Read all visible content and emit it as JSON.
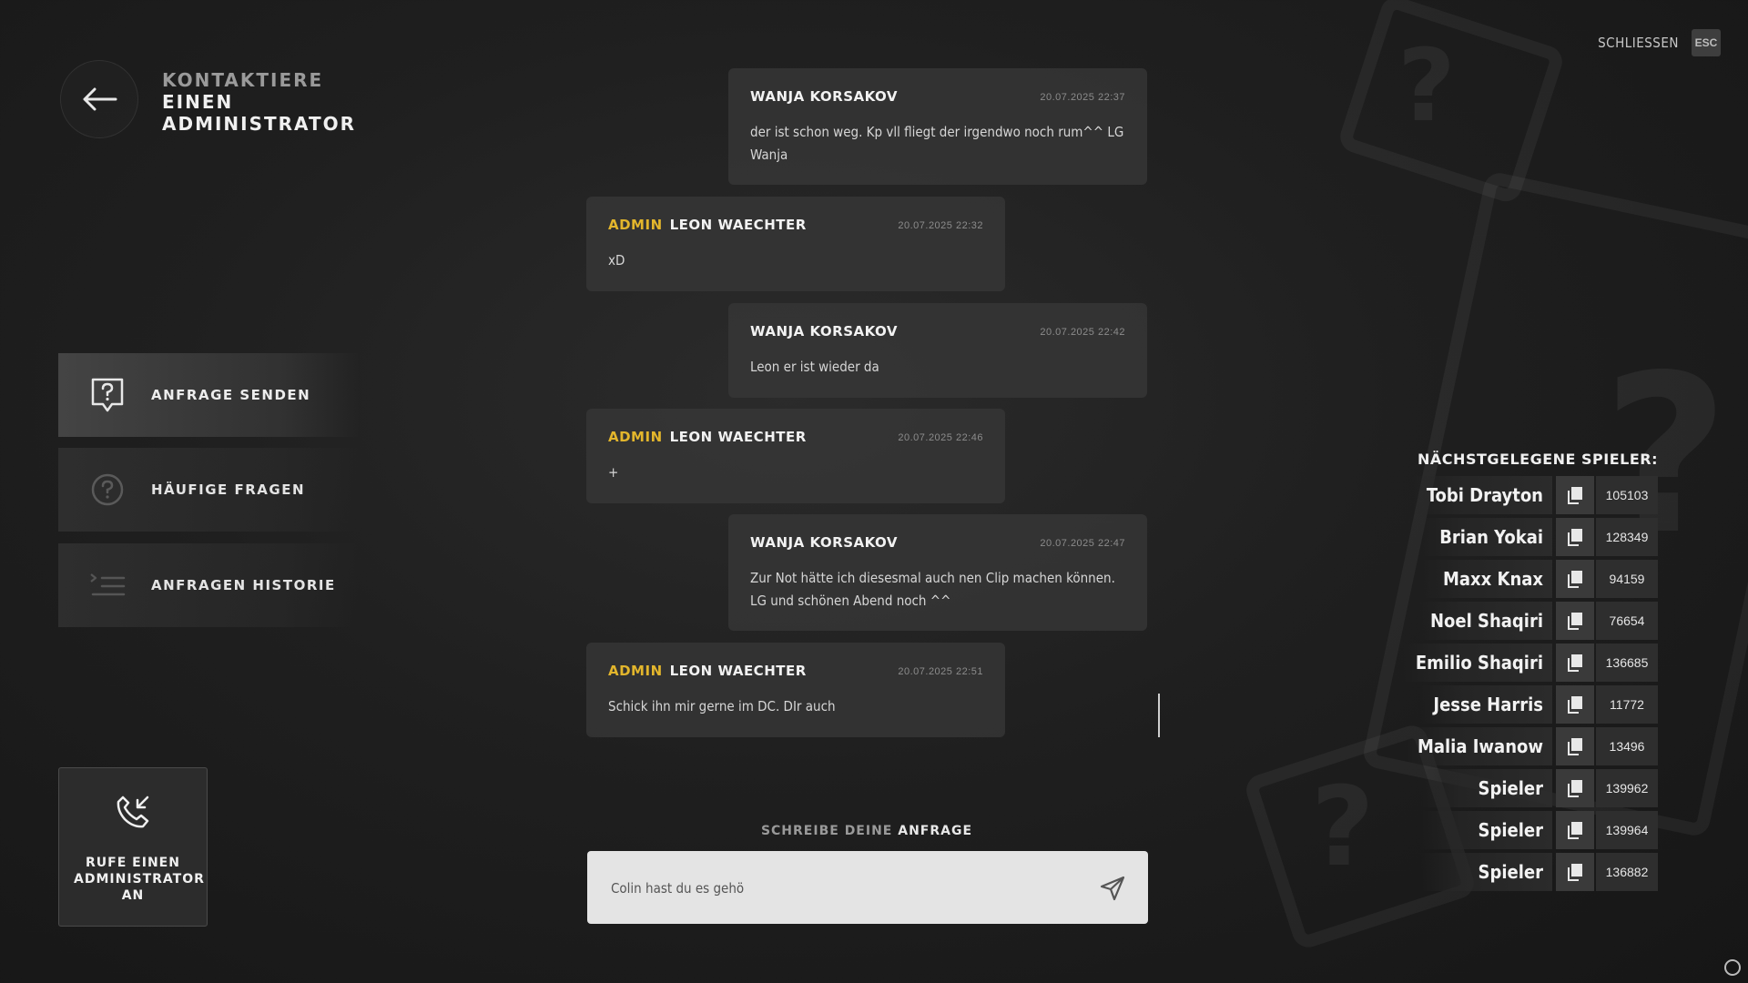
{
  "header": {
    "title_line1": "KONTAKTIERE",
    "title_line2": "EINEN",
    "title_line3": "ADMINISTRATOR",
    "close_label": "SCHLIESSEN",
    "esc_key": "ESC"
  },
  "sidebar": {
    "items": [
      {
        "label": "ANFRAGE SENDEN",
        "icon": "question-bubble-icon",
        "active": true
      },
      {
        "label": "HÄUFIGE FRAGEN",
        "icon": "question-circle-icon",
        "active": false
      },
      {
        "label": "ANFRAGEN HISTORIE",
        "icon": "list-icon",
        "active": false
      }
    ],
    "call_button": {
      "label": "RUFE EINEN ADMINISTRATOR AN",
      "icon": "phone-incoming-icon"
    }
  },
  "chat": {
    "messages": [
      {
        "role": "",
        "author": "WANJA KORSAKOV",
        "time": "20.07.2025 22:37",
        "text": "der ist schon weg. Kp vll fliegt der irgendwo noch rum^^ LG Wanja",
        "side": "right"
      },
      {
        "role": "ADMIN",
        "author": "LEON WAECHTER",
        "time": "20.07.2025 22:32",
        "text": "xD",
        "side": "left"
      },
      {
        "role": "",
        "author": "WANJA KORSAKOV",
        "time": "20.07.2025 22:42",
        "text": "Leon er ist wieder da",
        "side": "right"
      },
      {
        "role": "ADMIN",
        "author": "LEON WAECHTER",
        "time": "20.07.2025 22:46",
        "text": "+",
        "side": "left"
      },
      {
        "role": "",
        "author": "WANJA KORSAKOV",
        "time": "20.07.2025 22:47",
        "text": "Zur Not hätte ich diesesmal auch nen Clip machen können. LG und schönen Abend noch ^^",
        "side": "right"
      },
      {
        "role": "ADMIN",
        "author": "LEON WAECHTER",
        "time": "20.07.2025 22:51",
        "text": "Schick ihn mir gerne im DC. DIr auch",
        "side": "left"
      }
    ],
    "write_label_a": "SCHREIBE DEINE",
    "write_label_b": "ANFRAGE",
    "input_value": "Colin hast du es gehö",
    "send_icon": "paper-plane-icon"
  },
  "players": {
    "title": "NÄCHSTGELEGENE SPIELER:",
    "list": [
      {
        "name": "Tobi Drayton",
        "id": "105103"
      },
      {
        "name": "Brian Yokai",
        "id": "128349"
      },
      {
        "name": "Maxx Knax",
        "id": "94159"
      },
      {
        "name": "Noel Shaqiri",
        "id": "76654"
      },
      {
        "name": "Emilio Shaqiri",
        "id": "136685"
      },
      {
        "name": "Jesse Harris",
        "id": "11772"
      },
      {
        "name": "Malia Iwanow",
        "id": "13496"
      },
      {
        "name": "Spieler",
        "id": "139962"
      },
      {
        "name": "Spieler",
        "id": "139964"
      },
      {
        "name": "Spieler",
        "id": "136882"
      }
    ]
  },
  "colors": {
    "accent_admin": "#e3b62c",
    "input_bg": "#e4e4e4"
  }
}
